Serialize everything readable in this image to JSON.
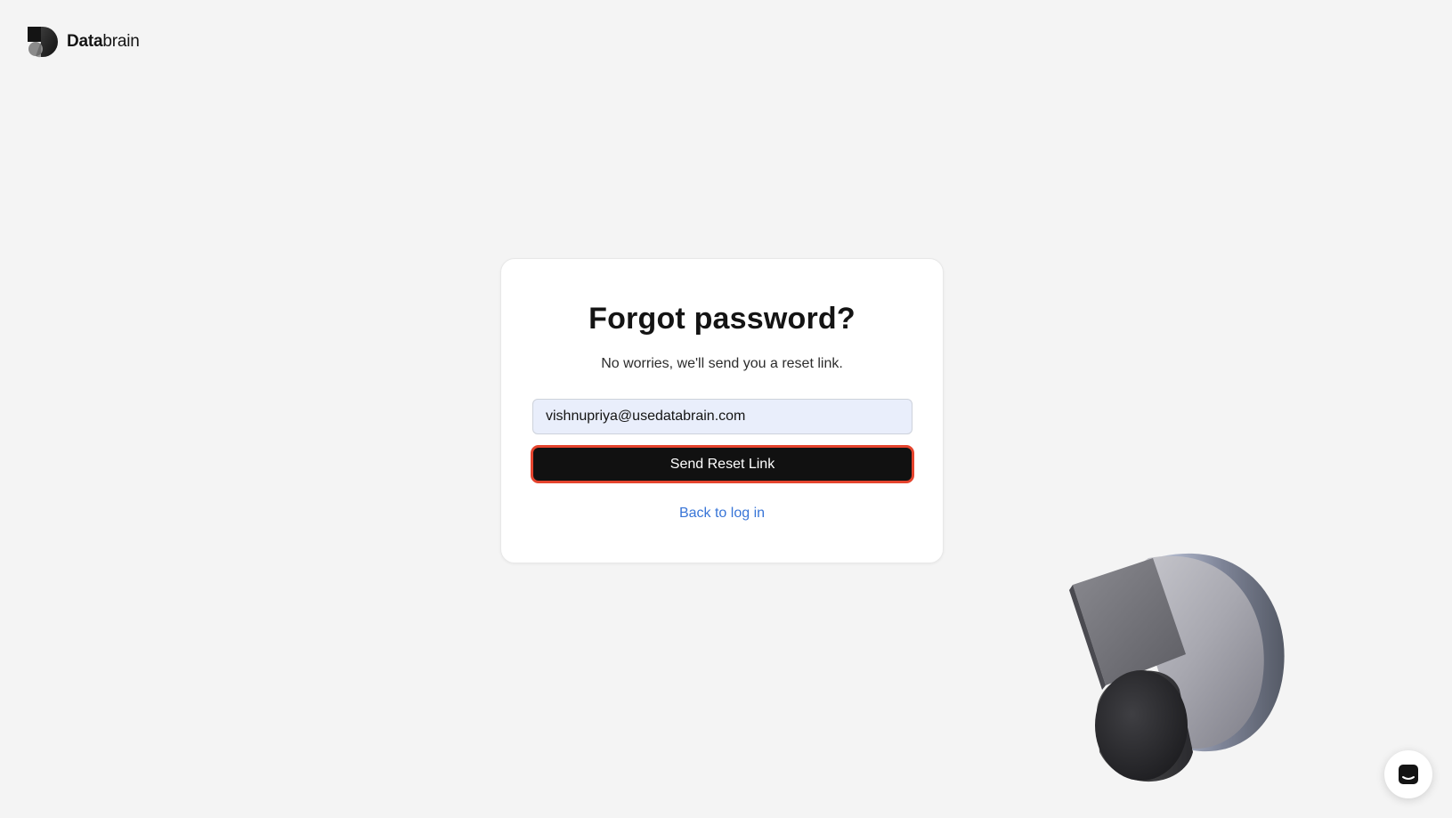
{
  "brand": {
    "name_bold": "Data",
    "name_light": "brain"
  },
  "form": {
    "title": "Forgot password?",
    "subtitle": "No worries, we'll send you a reset link.",
    "email_value": "vishnupriya@usedatabrain.com",
    "submit_label": "Send Reset Link",
    "back_link": "Back to log in"
  },
  "colors": {
    "background": "#f4f4f4",
    "button_bg": "#111111",
    "button_focus_ring": "#e5442e",
    "link": "#3875d7",
    "input_bg": "#e9eefb"
  },
  "icons": {
    "logo": "databrain-logo-icon",
    "chat": "chat-icon",
    "decoration": "databrain-3d-shape"
  }
}
